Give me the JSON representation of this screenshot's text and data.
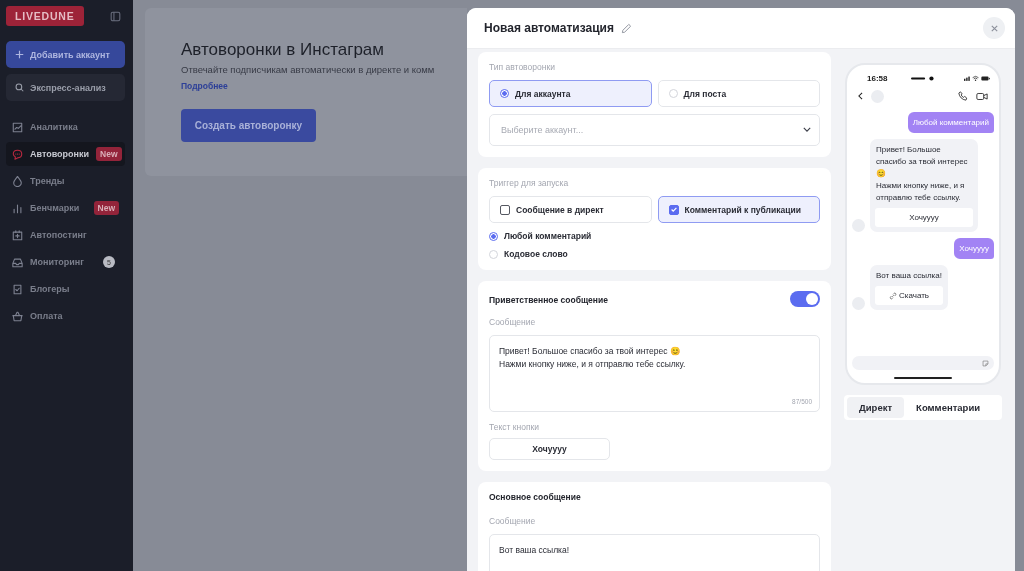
{
  "sidebar": {
    "logo": "LIVEDUNE",
    "add_button": "Добавить аккаунт",
    "express_button": "Экспресс-анализ",
    "items": [
      {
        "label": "Аналитика",
        "selected": false
      },
      {
        "label": "Автоворонки",
        "selected": true,
        "badge": {
          "kind": "new",
          "text": "New"
        }
      },
      {
        "label": "Тренды",
        "selected": false
      },
      {
        "label": "Бенчмарки",
        "selected": false,
        "badge": {
          "kind": "new",
          "text": "New"
        }
      },
      {
        "label": "Автопостинг",
        "selected": false
      },
      {
        "label": "Мониторинг",
        "selected": false,
        "badge": {
          "kind": "count",
          "text": "5"
        }
      },
      {
        "label": "Блогеры",
        "selected": false
      },
      {
        "label": "Оплата",
        "selected": false
      }
    ]
  },
  "page": {
    "title": "Автоворонки в Инстаграм",
    "subtitle": "Отвечайте подписчикам автоматически в директе и комм",
    "link": "Подробнее",
    "create_button": "Создать автоворонку"
  },
  "modal": {
    "title": "Новая автоматизация",
    "type_section": {
      "label": "Тип автоворонки",
      "options": [
        {
          "label": "Для аккаунта",
          "selected": true
        },
        {
          "label": "Для поста",
          "selected": false
        }
      ],
      "account_select": {
        "placeholder": "Выберите аккаунт..."
      }
    },
    "trigger_section": {
      "label": "Триггер для запуска",
      "sources": [
        {
          "label": "Сообщение в директ",
          "checked": false
        },
        {
          "label": "Комментарий к публикации",
          "checked": true
        }
      ],
      "comment_modes": [
        {
          "label": "Любой комментарий",
          "selected": true
        },
        {
          "label": "Кодовое слово",
          "selected": false
        }
      ]
    },
    "welcome": {
      "title": "Приветственное сообщение",
      "enabled": true,
      "message_label": "Сообщение",
      "message": "Привет! Большое спасибо за твой интерес 😊\nНажми кнопку ниже, и я отправлю тебе ссылку.",
      "counter": "87/500",
      "button_label": "Текст кнопки",
      "button_text": "Хочуууу"
    },
    "main": {
      "title": "Основное сообщение",
      "message_label": "Сообщение",
      "message": "Вот ваша ссылка!"
    }
  },
  "preview": {
    "time": "16:58",
    "messages": [
      {
        "kind": "outgoing",
        "text": "Любой комментарий"
      },
      {
        "kind": "incoming",
        "text": "Привет! Большое спасибо за твой интерес 😊\nНажми кнопку ниже, и я отправлю тебе ссылку.",
        "button": {
          "text": "Хочуууу"
        }
      },
      {
        "kind": "outgoing",
        "text": "Хочуууу"
      },
      {
        "kind": "incoming",
        "text": "Вот ваша ссылка!",
        "button": {
          "text": "Скачать",
          "kind": "link"
        }
      }
    ],
    "tabs": [
      {
        "label": "Директ",
        "selected": true
      },
      {
        "label": "Комментарии",
        "selected": false
      }
    ]
  }
}
